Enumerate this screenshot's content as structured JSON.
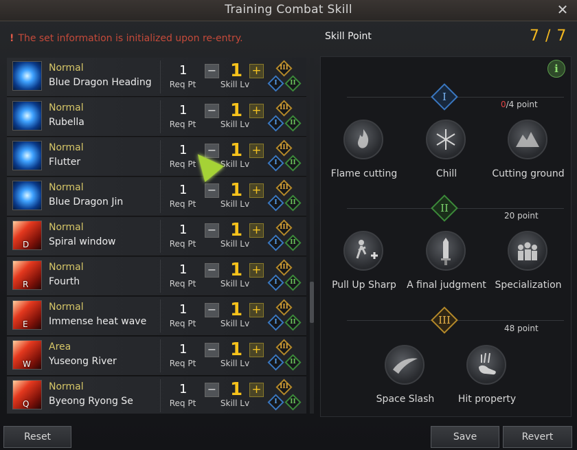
{
  "window": {
    "title": "Training Combat Skill"
  },
  "warning": {
    "text": "The set information is initialized upon re-entry."
  },
  "skill_point": {
    "label": "Skill Point",
    "value": "7 / 7"
  },
  "labels": {
    "req_pt": "Req Pt",
    "skill_lv": "Skill Lv"
  },
  "skills": [
    {
      "type": "Normal",
      "name": "Blue Dragon Heading",
      "req": "1",
      "lv": "1",
      "key": "",
      "theme": "blue"
    },
    {
      "type": "Normal",
      "name": "Rubella",
      "req": "1",
      "lv": "1",
      "key": "",
      "theme": "blue"
    },
    {
      "type": "Normal",
      "name": "Flutter",
      "req": "1",
      "lv": "1",
      "key": "",
      "theme": "blue"
    },
    {
      "type": "Normal",
      "name": "Blue Dragon Jin",
      "req": "1",
      "lv": "1",
      "key": "",
      "theme": "blue"
    },
    {
      "type": "Normal",
      "name": "Spiral window",
      "req": "1",
      "lv": "1",
      "key": "D",
      "theme": "red"
    },
    {
      "type": "Normal",
      "name": "Fourth",
      "req": "1",
      "lv": "1",
      "key": "R",
      "theme": "red"
    },
    {
      "type": "Normal",
      "name": "Immense heat wave",
      "req": "1",
      "lv": "1",
      "key": "E",
      "theme": "red"
    },
    {
      "type": "Area",
      "name": "Yuseong River",
      "req": "1",
      "lv": "1",
      "key": "W",
      "theme": "red"
    },
    {
      "type": "Normal",
      "name": "Byeong Ryong Se",
      "req": "1",
      "lv": "1",
      "key": "Q",
      "theme": "red"
    }
  ],
  "tiers": [
    {
      "numeral": "I",
      "point_used": "0",
      "point_text": "/4 point",
      "color": "#3a77c0",
      "nodes": [
        {
          "name": "Flame cutting",
          "icon": "flame-icon"
        },
        {
          "name": "Chill",
          "icon": "snowflake-icon"
        },
        {
          "name": "Cutting ground",
          "icon": "rocks-icon"
        }
      ]
    },
    {
      "numeral": "II",
      "point_used": "",
      "point_text": "20 point",
      "color": "#3c8a3a",
      "nodes": [
        {
          "name": "Pull Up Sharp",
          "icon": "figure-plus-icon"
        },
        {
          "name": "A final judgment",
          "icon": "sword-icon"
        },
        {
          "name": "Specialization",
          "icon": "crowd-icon"
        }
      ]
    },
    {
      "numeral": "III",
      "point_used": "",
      "point_text": "48 point",
      "color": "#b4892a",
      "nodes": [
        {
          "name": "Space Slash",
          "icon": "slash-icon"
        },
        {
          "name": "Hit property",
          "icon": "hand-icon"
        }
      ]
    }
  ],
  "buttons": {
    "reset": "Reset",
    "save": "Save",
    "revert": "Revert"
  },
  "colors": {
    "accent": "#f3b820",
    "warning": "#c54a3a",
    "type_label": "#d7c768"
  }
}
